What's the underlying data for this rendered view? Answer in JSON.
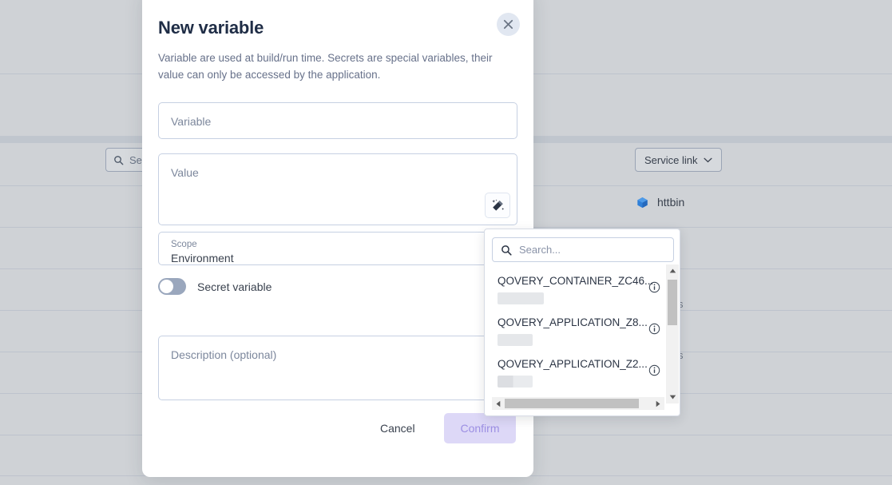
{
  "background": {
    "search": {
      "placeholder": "Search",
      "icon": "search-icon"
    },
    "service_link": {
      "label": "Service link",
      "icon": "chevron-down-icon"
    },
    "service_rows": [
      {
        "name": "httbin",
        "icon": "cube-icon"
      }
    ],
    "faint_labels": [
      "s",
      "s"
    ]
  },
  "modal": {
    "title": "New variable",
    "description": "Variable are used at build/run time. Secrets are special variables, their value can only be accessed by the application.",
    "close_icon": "close-icon",
    "fields": {
      "variable": {
        "placeholder": "Variable",
        "value": ""
      },
      "value": {
        "placeholder": "Value",
        "value": "",
        "action_icon": "magic-wand-icon"
      },
      "scope": {
        "label": "Scope",
        "value": "Environment"
      },
      "description": {
        "placeholder": "Description (optional)",
        "value": ""
      }
    },
    "secret_toggle": {
      "label": "Secret variable",
      "state": "off"
    },
    "footer": {
      "cancel_label": "Cancel",
      "confirm_label": "Confirm"
    }
  },
  "dropdown": {
    "search": {
      "placeholder": "Search...",
      "icon": "search-icon"
    },
    "items": [
      {
        "name": "QOVERY_CONTAINER_ZC46...",
        "info_icon": "info-icon",
        "skeleton": "single"
      },
      {
        "name": "QOVERY_APPLICATION_Z8...",
        "info_icon": "info-icon",
        "skeleton": "single"
      },
      {
        "name": "QOVERY_APPLICATION_Z2...",
        "info_icon": "info-icon",
        "skeleton": "double"
      }
    ],
    "vertical_scrollbar": {
      "up_icon": "caret-up-icon",
      "down_icon": "caret-down-icon"
    },
    "horizontal_scrollbar": {
      "left_icon": "caret-left-icon",
      "right_icon": "caret-right-icon"
    }
  },
  "colors": {
    "accent": "#9c8fe3",
    "confirm_bg": "#ddd8f7",
    "page_bg": "#cfd2d6",
    "title": "#1f2d46"
  }
}
